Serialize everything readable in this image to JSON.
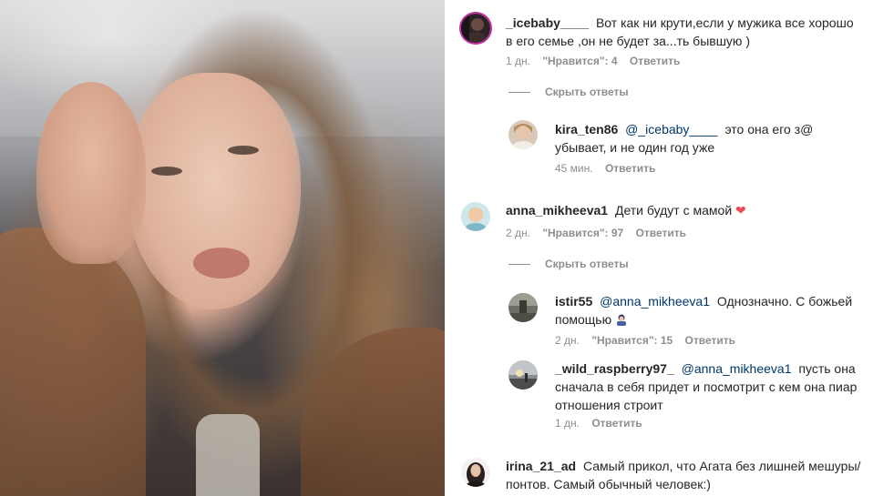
{
  "comments": [
    {
      "username": "_icebaby____",
      "text": "Вот как ни крути,если у мужика все хорошо в его семье ,он не будет за...ть бывшую )",
      "time": "1 дн.",
      "likes": "\"Нравится\": 4",
      "reply": "Ответить",
      "toggle": "Скрыть ответы",
      "replies": [
        {
          "username": "kira_ten86",
          "mention": "@_icebaby____",
          "text": "это она его з@ убывает, и не один год уже",
          "time": "45 мин.",
          "reply": "Ответить"
        }
      ]
    },
    {
      "username": "anna_mikheeva1",
      "text": "Дети будут с мамой",
      "emoji": "❤",
      "time": "2 дн.",
      "likes": "\"Нравится\": 97",
      "reply": "Ответить",
      "toggle": "Скрыть ответы",
      "replies": [
        {
          "username": "istir55",
          "mention": "@anna_mikheeva1",
          "text": "Однозначно. С божьей помощью",
          "emoji": "person-bowing-emoji",
          "time": "2 дн.",
          "likes": "\"Нравится\": 15",
          "reply": "Ответить"
        },
        {
          "username": "_wild_raspberry97_",
          "mention": "@anna_mikheeva1",
          "text": "пусть она сначала в себя придет и посмотрит с кем она пиар отношения строит",
          "time": "1 дн.",
          "reply": "Ответить"
        }
      ]
    },
    {
      "username": "irina_21_ad",
      "text": "Самый прикол, что Агата без лишней мешуры/понтов. Самый обычный человек:)"
    }
  ],
  "colors": {
    "text": "#262626",
    "meta": "#8e8e8e",
    "mention": "#00376b",
    "heart": "#ed4956",
    "story_ring": "#c32aa3"
  }
}
